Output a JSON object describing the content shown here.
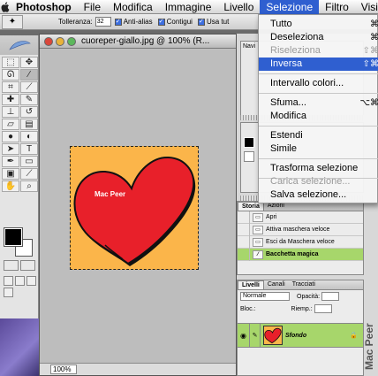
{
  "menubar": {
    "items": [
      "Photoshop",
      "File",
      "Modifica",
      "Immagine",
      "Livello",
      "Selezione",
      "Filtro",
      "Visi"
    ],
    "active_index": 5
  },
  "options_bar": {
    "tolerance_label": "Tolleranza:",
    "tolerance_value": "32",
    "antialias_label": "Anti-alias",
    "contiguous_label": "Contigui",
    "use_all_label": "Usa tut"
  },
  "document": {
    "title": "cuoreper-giallo.jpg @ 100% (R...",
    "zoom": "100%",
    "image_text": "Mac Peer"
  },
  "dropdown": {
    "items": [
      {
        "label": "Tutto",
        "shortcut": "⌘",
        "disabled": false,
        "highlighted": false
      },
      {
        "label": "Deseleziona",
        "shortcut": "⌘",
        "disabled": false,
        "highlighted": false
      },
      {
        "label": "Riseleziona",
        "shortcut": "⇧⌘",
        "disabled": true,
        "highlighted": false
      },
      {
        "label": "Inversa",
        "shortcut": "⇧⌘",
        "disabled": false,
        "highlighted": true
      },
      {
        "label": "Intervallo colori...",
        "shortcut": "",
        "disabled": false,
        "highlighted": false
      },
      {
        "label": "Sfuma...",
        "shortcut": "⌥⌘",
        "disabled": false,
        "highlighted": false
      },
      {
        "label": "Modifica",
        "shortcut": "",
        "disabled": false,
        "highlighted": false
      },
      {
        "label": "Estendi",
        "shortcut": "",
        "disabled": false,
        "highlighted": false
      },
      {
        "label": "Simile",
        "shortcut": "",
        "disabled": false,
        "highlighted": false
      },
      {
        "label": "Trasforma selezione",
        "shortcut": "",
        "disabled": false,
        "highlighted": false
      },
      {
        "label": "Carica selezione...",
        "shortcut": "",
        "disabled": true,
        "highlighted": false
      },
      {
        "label": "Salva selezione...",
        "shortcut": "",
        "disabled": false,
        "highlighted": false
      }
    ]
  },
  "navigator": {
    "tab": "Navi"
  },
  "history": {
    "tabs": [
      "Storia",
      "Azioni"
    ],
    "rows": [
      "Apri",
      "Attiva maschera veloce",
      "Esci da Maschera veloce",
      "Bacchetta magica"
    ],
    "selected_index": 3
  },
  "layers": {
    "tabs": [
      "Livelli",
      "Canali",
      "Tracciati"
    ],
    "blend_mode": "Normale",
    "opacity_label": "Opacità:",
    "lock_label": "Bloc.:",
    "fill_label": "Riemp.:",
    "layer_name": "Sfondo"
  },
  "watermark": "Mac Peer",
  "colors": {
    "menu_highlight": "#2f5fd0",
    "image_background": "#fbb54a",
    "heart": "#e8202a",
    "history_selected": "#a7d66b"
  }
}
